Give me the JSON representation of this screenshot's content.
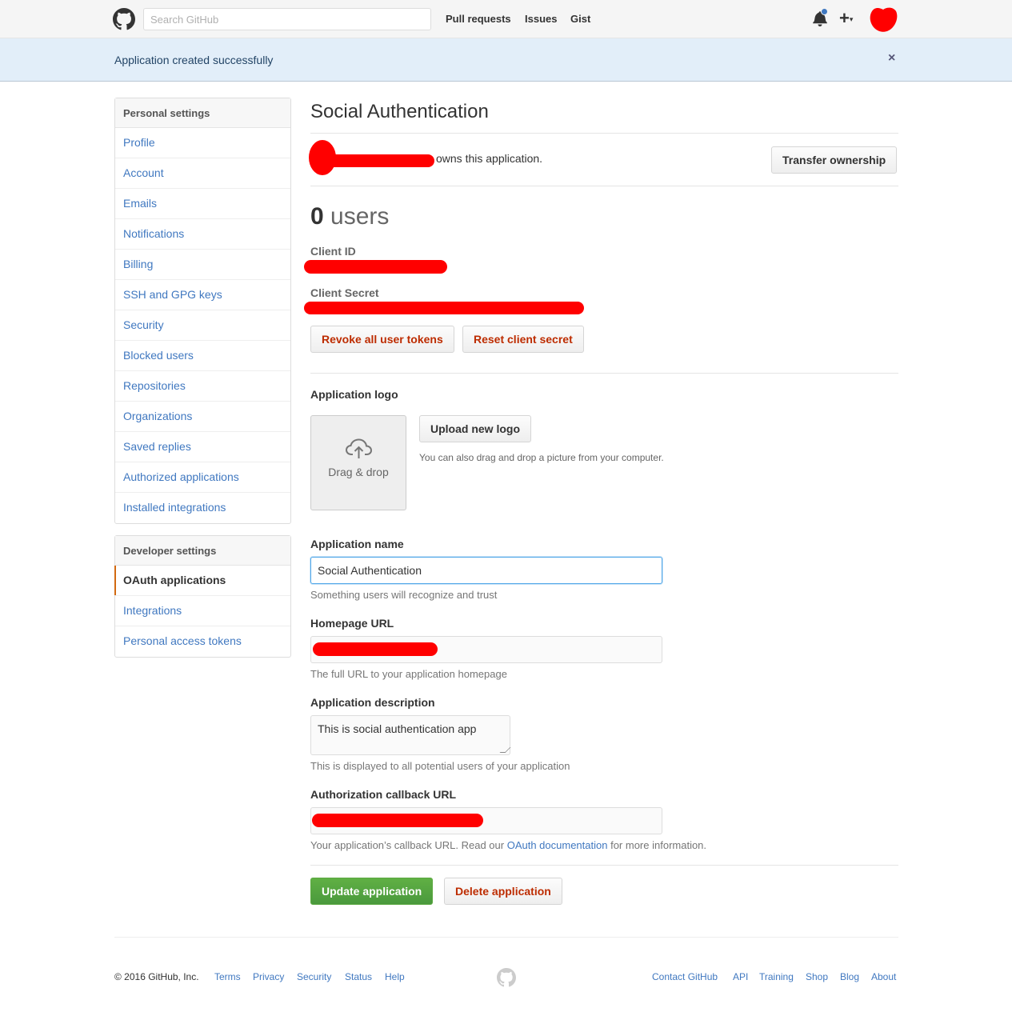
{
  "header": {
    "search_placeholder": "Search GitHub",
    "nav": [
      "Pull requests",
      "Issues",
      "Gist"
    ],
    "icons": [
      "github-mark-icon",
      "bell-icon",
      "plus-icon",
      "avatar"
    ]
  },
  "flash": {
    "message": "Application created successfully",
    "close": "×"
  },
  "sidebar": {
    "personal_heading": "Personal settings",
    "personal_items": [
      "Profile",
      "Account",
      "Emails",
      "Notifications",
      "Billing",
      "SSH and GPG keys",
      "Security",
      "Blocked users",
      "Repositories",
      "Organizations",
      "Saved replies",
      "Authorized applications",
      "Installed integrations"
    ],
    "developer_heading": "Developer settings",
    "developer_items": [
      "OAuth applications",
      "Integrations",
      "Personal access tokens"
    ],
    "selected": "OAuth applications"
  },
  "app": {
    "title": "Social Authentication",
    "owns_text": "owns this application.",
    "transfer_button": "Transfer ownership",
    "users_count": "0",
    "users_label": "users",
    "client_id_label": "Client ID",
    "client_secret_label": "Client Secret",
    "revoke_button": "Revoke all user tokens",
    "reset_button": "Reset client secret"
  },
  "logo_section": {
    "label": "Application logo",
    "drag_text": "Drag & drop",
    "upload_button": "Upload new logo",
    "upload_note": "You can also drag and drop a picture from your computer."
  },
  "form": {
    "name_label": "Application name",
    "name_value": "Social Authentication",
    "name_note": "Something users will recognize and trust",
    "homepage_label": "Homepage URL",
    "homepage_note": "The full URL to your application homepage",
    "description_label": "Application description",
    "description_value": "This is social authentication app",
    "description_note": "This is displayed to all potential users of your application",
    "callback_label": "Authorization callback URL",
    "callback_note_pre": "Your application’s callback URL. Read our",
    "callback_note_link": "OAuth documentation",
    "callback_note_post": "for more information.",
    "update_button": "Update application",
    "delete_button": "Delete application"
  },
  "footer": {
    "copyright": "© 2016 GitHub, Inc.",
    "left_links": [
      "Terms",
      "Privacy",
      "Security",
      "Status",
      "Help"
    ],
    "right_links": [
      "Contact GitHub",
      "API",
      "Training",
      "Shop",
      "Blog",
      "About"
    ]
  },
  "colors": {
    "link": "#4078c0",
    "danger": "#bd2c00",
    "primary": "#60b044",
    "flash_bg": "#e2eef9",
    "selected_accent": "#d26911"
  }
}
